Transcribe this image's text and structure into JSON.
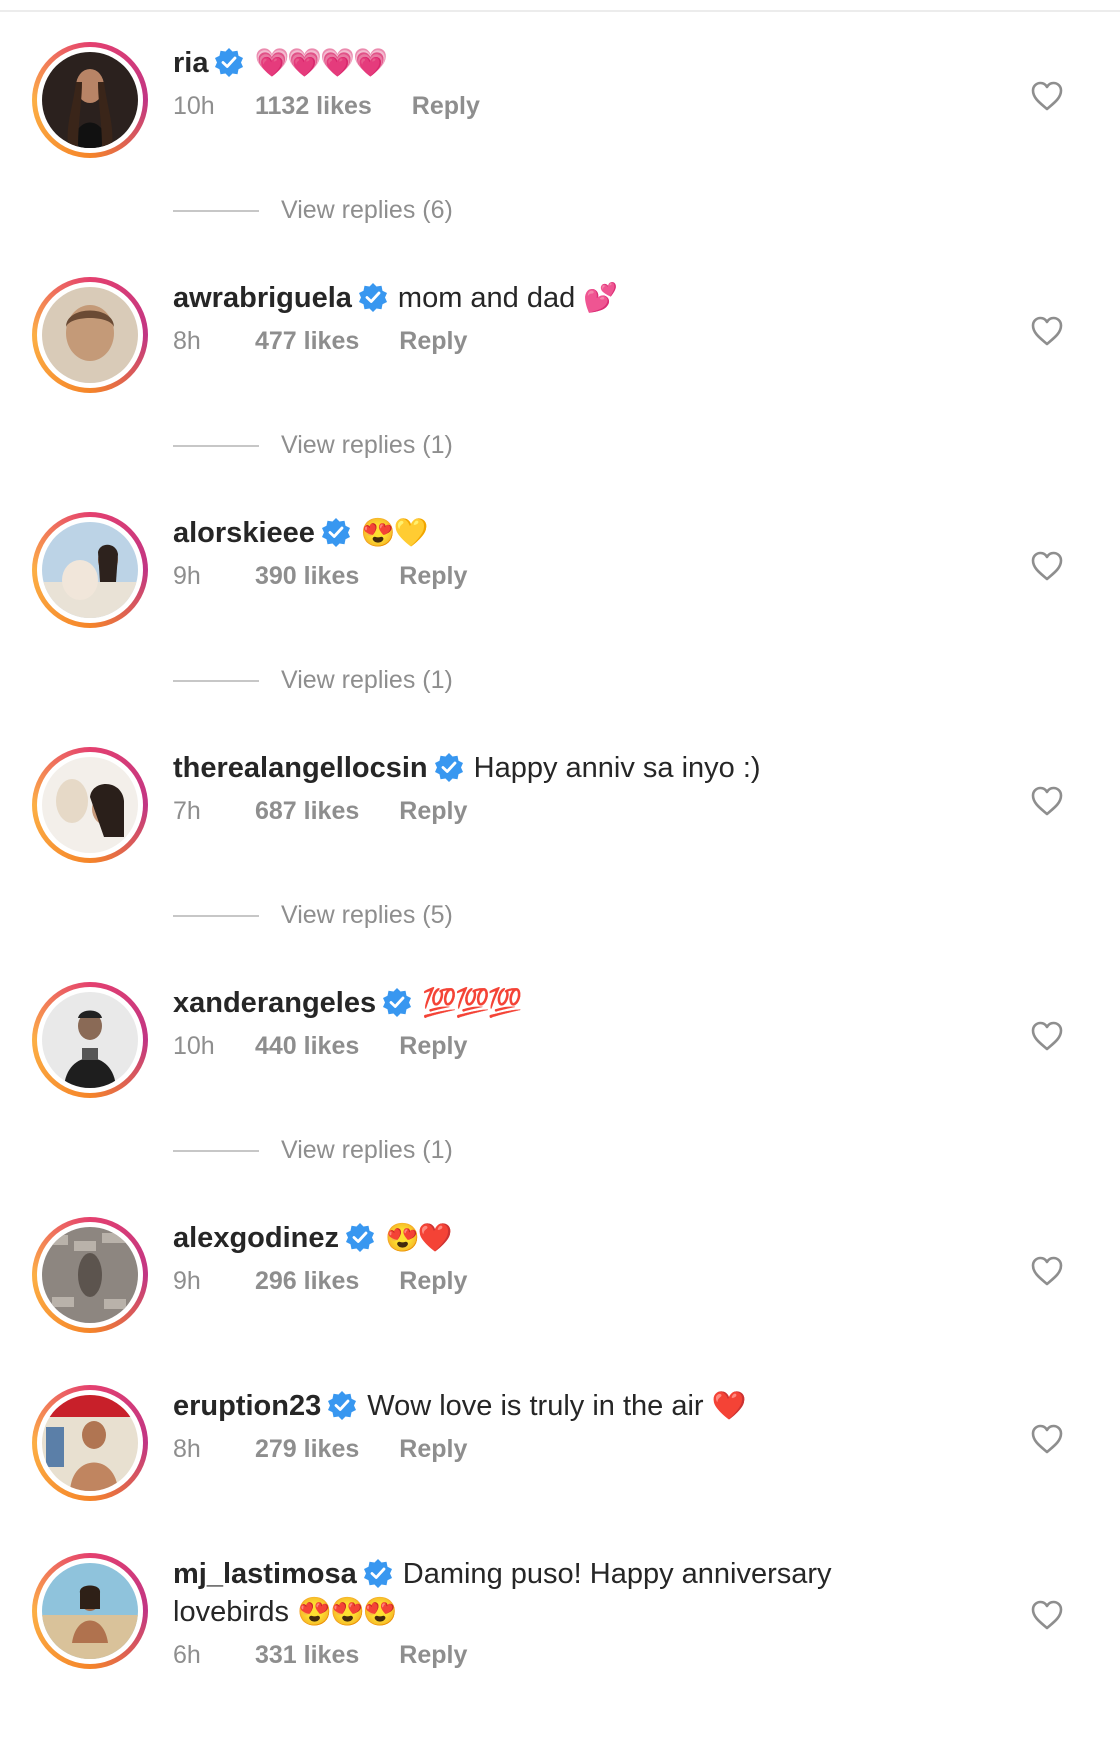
{
  "comments": [
    {
      "username": "ria",
      "text": "",
      "emoji": "💗💗💗💗",
      "time": "10h",
      "likes": "1132 likes",
      "reply": "Reply",
      "view_replies": "View replies (6)"
    },
    {
      "username": "awrabriguela",
      "text": "mom and dad",
      "emoji": "💕",
      "time": "8h",
      "likes": "477 likes",
      "reply": "Reply",
      "view_replies": "View replies (1)"
    },
    {
      "username": "alorskieee",
      "text": "",
      "emoji": "😍💛",
      "time": "9h",
      "likes": "390 likes",
      "reply": "Reply",
      "view_replies": "View replies (1)"
    },
    {
      "username": "therealangellocsin",
      "text": "Happy anniv sa inyo :)",
      "emoji": "",
      "time": "7h",
      "likes": "687 likes",
      "reply": "Reply",
      "view_replies": "View replies (5)"
    },
    {
      "username": "xanderangeles",
      "text": "",
      "emoji": "💯💯💯",
      "time": "10h",
      "likes": "440 likes",
      "reply": "Reply",
      "view_replies": "View replies (1)"
    },
    {
      "username": "alexgodinez",
      "text": "",
      "emoji": "😍❤️",
      "time": "9h",
      "likes": "296 likes",
      "reply": "Reply",
      "view_replies": ""
    },
    {
      "username": "eruption23",
      "text": "Wow love is truly in the air",
      "emoji": "❤️",
      "time": "8h",
      "likes": "279 likes",
      "reply": "Reply",
      "view_replies": ""
    },
    {
      "username": "mj_lastimosa",
      "text": "Daming puso! Happy anniversary lovebirds",
      "emoji": "😍😍😍",
      "time": "6h",
      "likes": "331 likes",
      "reply": "Reply",
      "view_replies": ""
    }
  ],
  "colors": {
    "verified": "#3897f0",
    "muted": "#8e8e8e",
    "text": "#262626"
  },
  "icons": {
    "verified": "verified-badge-icon",
    "like": "heart-outline-icon"
  }
}
